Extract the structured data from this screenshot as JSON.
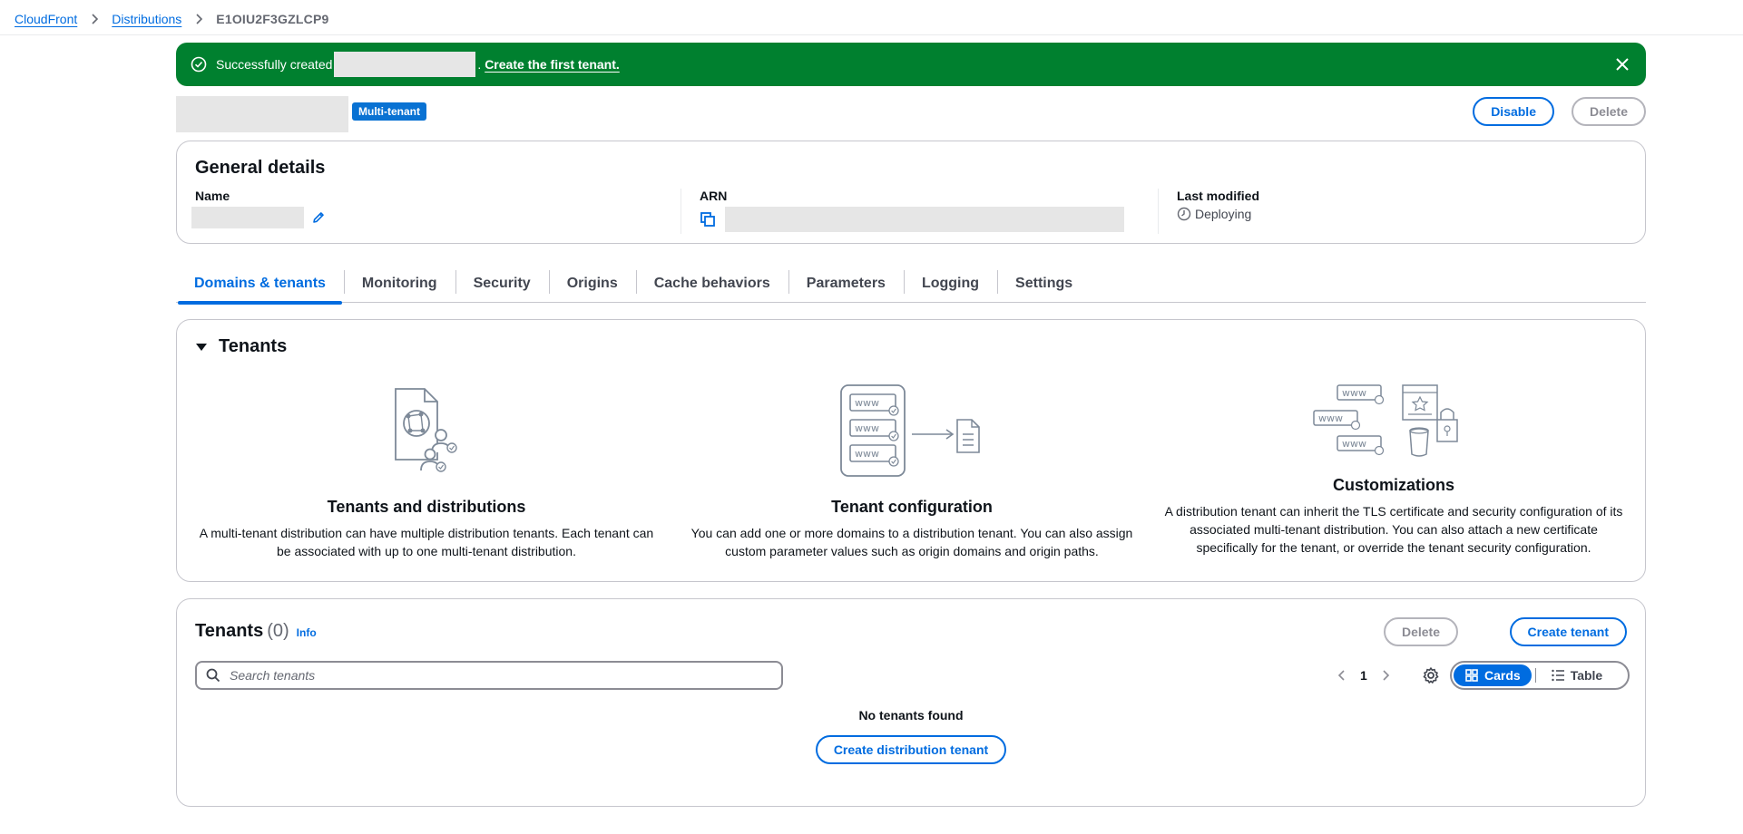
{
  "breadcrumb": {
    "items": [
      "CloudFront",
      "Distributions"
    ],
    "current": "E1OIU2F3GZLCP9"
  },
  "flash": {
    "text_before": "Successfully created ",
    "text_after": ". ",
    "link": "Create the first tenant.",
    "type": "success",
    "color": "#00802f"
  },
  "header": {
    "badge": "Multi-tenant",
    "disable_label": "Disable",
    "delete_label": "Delete"
  },
  "general": {
    "title": "General details",
    "name_label": "Name",
    "arn_label": "ARN",
    "modified_label": "Last modified",
    "modified_value": "Deploying"
  },
  "tabs": [
    "Domains & tenants",
    "Monitoring",
    "Security",
    "Origins",
    "Cache behaviors",
    "Parameters",
    "Logging",
    "Settings"
  ],
  "active_tab": 0,
  "tenants_section": {
    "title": "Tenants",
    "features": [
      {
        "icon": "tenants-distributions-illustration",
        "title": "Tenants and distributions",
        "desc": "A multi-tenant distribution can have multiple distribution tenants. Each tenant can be associated with up to one multi-tenant distribution."
      },
      {
        "icon": "tenant-configuration-illustration",
        "title": "Tenant configuration",
        "desc": "You can add one or more domains to a distribution tenant. You can also assign custom parameter values such as origin domains and origin paths."
      },
      {
        "icon": "customizations-illustration",
        "title": "Customizations",
        "desc": "A distribution tenant can inherit the TLS certificate and security configuration of its associated multi-tenant distribution. You can also attach a new certificate specifically for the tenant, or override the tenant security configuration."
      }
    ]
  },
  "tenants_table": {
    "title": "Tenants",
    "count": "(0)",
    "info": "Info",
    "delete_label": "Delete",
    "create_label": "Create tenant",
    "search_placeholder": "Search tenants",
    "page": "1",
    "view_cards": "Cards",
    "view_table": "Table",
    "empty_text": "No tenants found",
    "empty_button": "Create distribution tenant"
  },
  "colors": {
    "accent": "#006ce0",
    "success": "#00802f",
    "badge": "#0972d3"
  }
}
